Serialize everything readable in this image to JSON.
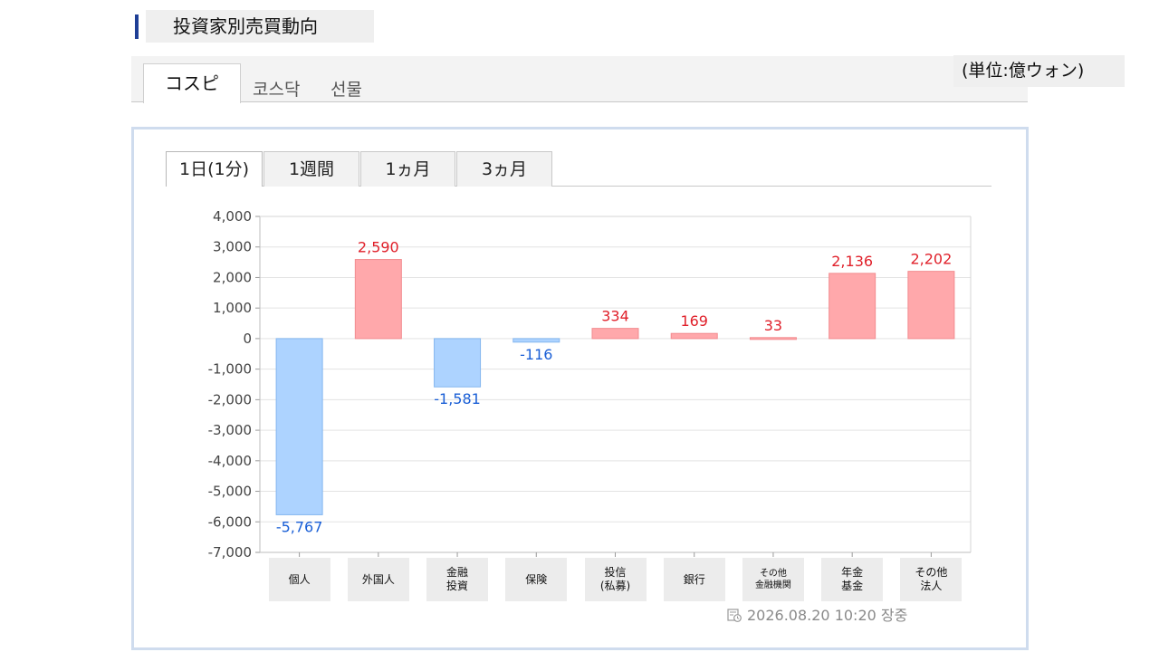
{
  "header": {
    "title": "投資家別売買動向"
  },
  "market_tabs": [
    {
      "label": "コスピ",
      "active": true
    },
    {
      "label": "코스닥",
      "active": false
    },
    {
      "label": "선물",
      "active": false
    }
  ],
  "unit_label": "(単位:億ウォン)",
  "period_tabs": [
    {
      "label": "1日(1分)",
      "active": true
    },
    {
      "label": "1週間",
      "active": false
    },
    {
      "label": "1ヵ月",
      "active": false
    },
    {
      "label": "3ヵ月",
      "active": false
    }
  ],
  "chart_data": {
    "type": "bar",
    "categories": [
      "個人",
      "外国人",
      "金融\n投資",
      "保険",
      "投信\n(私募)",
      "銀行",
      "その他\n金融機関",
      "年金\n基金",
      "その他\n法人"
    ],
    "values": [
      -5767,
      2590,
      -1581,
      -116,
      334,
      169,
      33,
      2136,
      2202
    ],
    "value_labels": [
      "-5,767",
      "2,590",
      "-1,581",
      "-116",
      "334",
      "169",
      "33",
      "2,136",
      "2,202"
    ],
    "yticks": [
      "4,000",
      "3,000",
      "2,000",
      "1,000",
      "0",
      "-1,000",
      "-2,000",
      "-3,000",
      "-4,000",
      "-5,000",
      "-6,000",
      "-7,000"
    ],
    "ylim": [
      -7000,
      4000
    ],
    "grid": true,
    "colors": {
      "positive_fill": "#ffa8ab",
      "positive_stroke": "#f28b8f",
      "positive_label": "#e0202a",
      "negative_fill": "#add3ff",
      "negative_stroke": "#84b6ef",
      "negative_label": "#1a5fd6"
    }
  },
  "timestamp": {
    "icon": "clock-icon",
    "text": "2026.08.20 10:20 장중"
  }
}
